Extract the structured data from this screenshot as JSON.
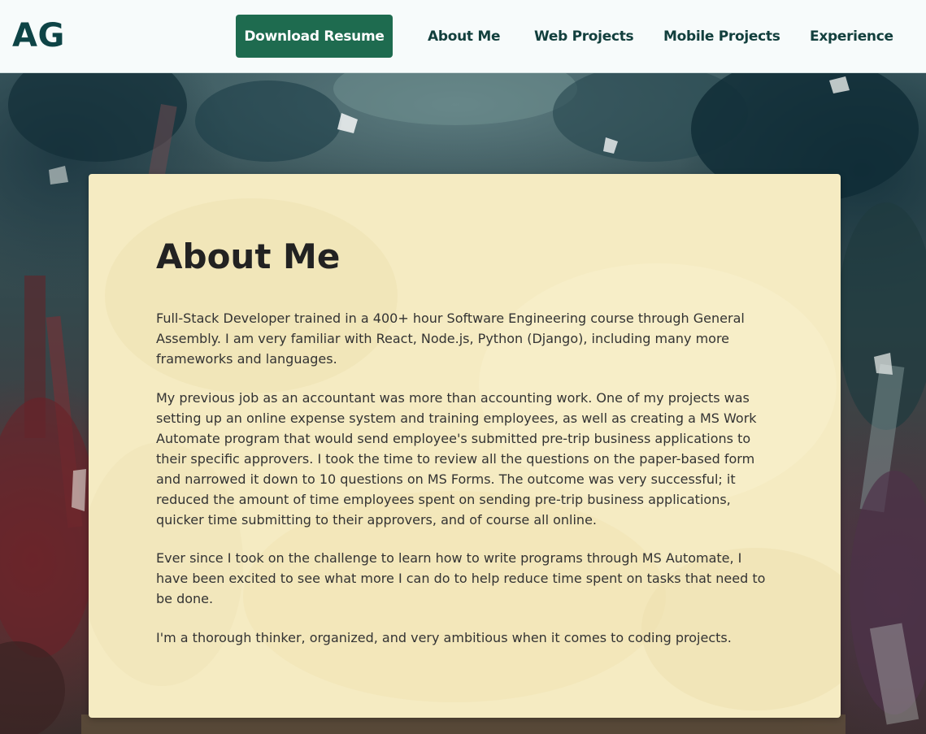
{
  "header": {
    "logo": "AG",
    "resume_button": "Download Resume",
    "nav": [
      {
        "label": "About Me"
      },
      {
        "label": "Web Projects"
      },
      {
        "label": "Mobile Projects"
      },
      {
        "label": "Experience"
      }
    ]
  },
  "about": {
    "title": "About Me",
    "paragraphs": [
      "Full-Stack Developer trained in a 400+ hour Software Engineering course through General Assembly. I am very familiar with React, Node.js, Python (Django), including many more frameworks and languages.",
      "My previous job as an accountant was more than accounting work. One of my projects was setting up an online expense system and training employees, as well as creating a MS Work Automate program that would send employee's submitted pre-trip business applications to their specific approvers. I took the time to review all the questions on the paper-based form and narrowed it down to 10 questions on MS Forms. The outcome was very successful; it reduced the amount of time employees spent on sending pre-trip business applications, quicker time submitting to their approvers, and of course all online.",
      "Ever since I took on the challenge to learn how to write programs through MS Automate, I have been excited to see what more I can do to help reduce time spent on tasks that need to be done.",
      "I'm a thorough thinker, organized, and very ambitious when it comes to coding projects."
    ]
  },
  "colors": {
    "header_bg": "#f7fbfb",
    "logo": "#0e4446",
    "button_bg": "#1e6b4f",
    "nav_text": "#123f3d",
    "card_bg": "#f5ebc2",
    "heading_text": "#222222",
    "body_text": "#333333"
  }
}
